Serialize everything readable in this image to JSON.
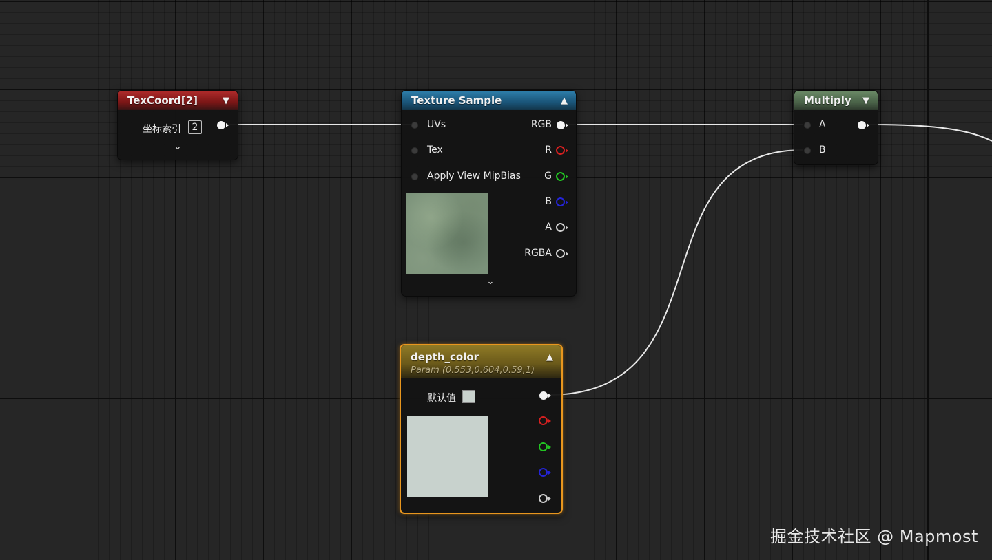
{
  "nodes": {
    "texcoord": {
      "title": "TexCoord[2]",
      "param_label": "坐标索引",
      "param_value": "2",
      "header_color": "#8c1f1f"
    },
    "texture_sample": {
      "title": "Texture Sample",
      "inputs": [
        "UVs",
        "Tex",
        "Apply View MipBias"
      ],
      "outputs": [
        "RGB",
        "R",
        "G",
        "B",
        "A",
        "RGBA"
      ],
      "header_color": "#1f5f86"
    },
    "multiply": {
      "title": "Multiply",
      "inputs": [
        "A",
        "B"
      ],
      "header_color": "#56704f"
    },
    "depth_color": {
      "title": "depth_color",
      "subtitle": "Param (0.553,0.604,0.59,1)",
      "default_label": "默认值",
      "header_color": "#7a6a1e",
      "selected_border_color": "#e8961e",
      "swatch_color": "#c8d2cd"
    }
  },
  "pin_colors": {
    "white": "#f4f4f4",
    "red": "#d62020",
    "green": "#22c422",
    "blue": "#2424d6",
    "gray": "#cfcfcf"
  },
  "watermark": "掘金技术社区 @ Mapmost"
}
